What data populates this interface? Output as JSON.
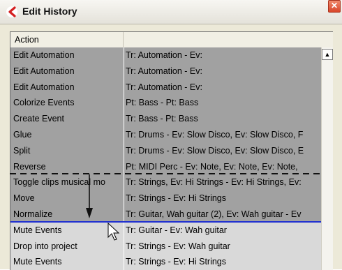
{
  "window": {
    "title": "Edit History",
    "close_glyph": "✕"
  },
  "table": {
    "columns": [
      "Action",
      ""
    ],
    "rows": [
      {
        "action": "Edit Automation",
        "details": "Tr: Automation - Ev:",
        "state": "done"
      },
      {
        "action": "Edit Automation",
        "details": "Tr: Automation - Ev:",
        "state": "done"
      },
      {
        "action": "Edit Automation",
        "details": "Tr: Automation - Ev:",
        "state": "done"
      },
      {
        "action": "Colorize Events",
        "details": "Pt: Bass - Pt: Bass",
        "state": "done"
      },
      {
        "action": "Create Event",
        "details": "Tr: Bass - Pt: Bass",
        "state": "done"
      },
      {
        "action": "Glue",
        "details": "Tr: Drums - Ev: Slow Disco, Ev: Slow Disco, F",
        "state": "done"
      },
      {
        "action": "Split",
        "details": "Tr: Drums - Ev: Slow Disco, Ev: Slow Disco, E",
        "state": "done"
      },
      {
        "action": "Reverse",
        "details": "Pt: MIDI Perc - Ev: Note, Ev: Note, Ev: Note,",
        "state": "done"
      },
      {
        "action": "Toggle clips musical mo",
        "details": "Tr: Strings, Ev: Hi Strings - Ev: Hi Strings, Ev:",
        "state": "done"
      },
      {
        "action": "Move",
        "details": "Tr: Strings - Ev: Hi Strings",
        "state": "done"
      },
      {
        "action": "Normalize",
        "details": "Tr: Guitar, Wah guitar (2), Ev: Wah guitar - Ev",
        "state": "done"
      },
      {
        "action": "Mute Events",
        "details": "Tr: Guitar - Ev: Wah guitar",
        "state": "undone"
      },
      {
        "action": "Drop into project",
        "details": "Tr: Strings - Ev: Wah guitar",
        "state": "undone"
      },
      {
        "action": "Mute Events",
        "details": "Tr: Strings - Ev: Hi Strings",
        "state": "undone"
      }
    ]
  },
  "scrollbar": {
    "up_glyph": "▲"
  },
  "colors": {
    "done_row": "#a1a1a1",
    "undone_row": "#d9d9d9",
    "undo_divider": "#2030d0"
  }
}
